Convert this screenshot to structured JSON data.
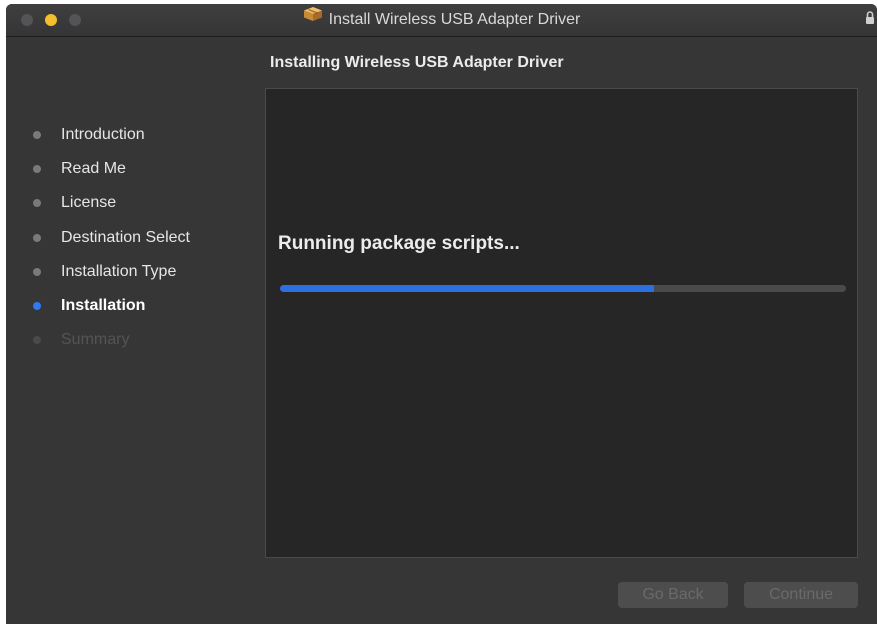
{
  "window": {
    "title": "Install Wireless USB Adapter Driver"
  },
  "header": {
    "subtitle": "Installing Wireless USB Adapter Driver"
  },
  "sidebar": {
    "steps": [
      {
        "label": "Introduction",
        "state": "done"
      },
      {
        "label": "Read Me",
        "state": "done"
      },
      {
        "label": "License",
        "state": "done"
      },
      {
        "label": "Destination Select",
        "state": "done"
      },
      {
        "label": "Installation Type",
        "state": "done"
      },
      {
        "label": "Installation",
        "state": "current"
      },
      {
        "label": "Summary",
        "state": "future"
      }
    ]
  },
  "main": {
    "status_text": "Running package scripts...",
    "progress_fraction": 0.66
  },
  "buttons": {
    "back_label": "Go Back",
    "continue_label": "Continue",
    "back_enabled": false,
    "continue_enabled": false
  },
  "icons": {
    "app": "package-icon",
    "lock": "lock-icon"
  },
  "colors": {
    "accent": "#2f7af0",
    "minimize": "#f5be2b",
    "background": "#363637",
    "panel": "#262626"
  }
}
